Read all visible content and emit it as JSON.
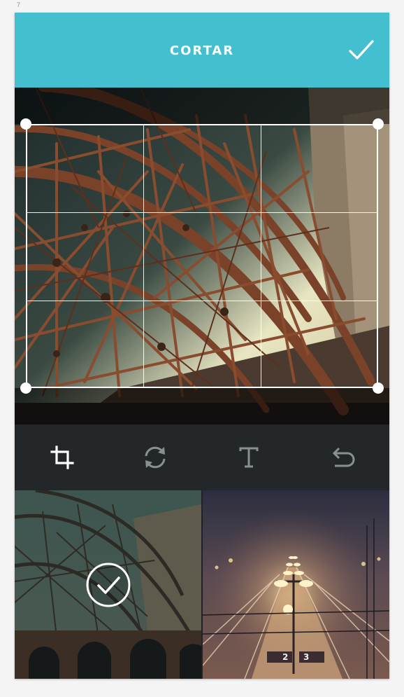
{
  "page_number": "7",
  "header": {
    "title": "CORTAR",
    "confirm_icon": "checkmark-icon"
  },
  "toolbar": {
    "tools": [
      {
        "name": "crop",
        "icon": "crop-icon",
        "active": true
      },
      {
        "name": "rotate",
        "icon": "rotate-icon",
        "active": false
      },
      {
        "name": "text",
        "icon": "text-icon",
        "active": false
      },
      {
        "name": "undo",
        "icon": "undo-icon",
        "active": false
      }
    ]
  },
  "thumbnails": {
    "items": [
      {
        "subject": "bridge-steel-structure",
        "selected": true
      },
      {
        "subject": "foggy-railway-lights",
        "selected": false
      }
    ],
    "sign_labels": [
      "2",
      "3"
    ]
  },
  "colors": {
    "header_bg": "#44bfcf",
    "toolbar_bg": "#232729",
    "canvas_bg": "#111417",
    "accent_white": "#ffffff"
  }
}
